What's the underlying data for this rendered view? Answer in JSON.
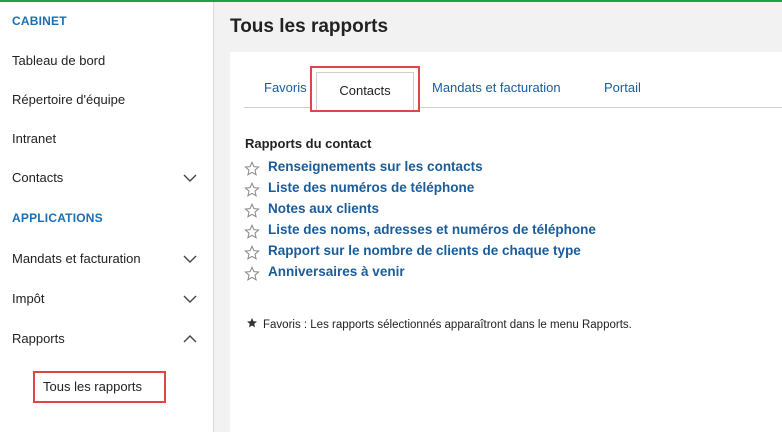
{
  "sidebar": {
    "section_cabinet": "CABINET",
    "section_applications": "APPLICATIONS",
    "items": [
      {
        "label": "Tableau de bord"
      },
      {
        "label": "Répertoire d'équipe"
      },
      {
        "label": "Intranet"
      },
      {
        "label": "Contacts"
      },
      {
        "label": "Mandats et facturation"
      },
      {
        "label": "Impôt"
      },
      {
        "label": "Rapports"
      }
    ],
    "sub_item": "Tous les rapports"
  },
  "main": {
    "title": "Tous les rapports",
    "tabs": [
      {
        "label": "Favoris"
      },
      {
        "label": "Contacts"
      },
      {
        "label": "Mandats et facturation"
      },
      {
        "label": "Portail"
      }
    ],
    "reports_heading": "Rapports du contact",
    "reports": [
      {
        "label": "Renseignements sur les contacts"
      },
      {
        "label": "Liste des numéros de téléphone"
      },
      {
        "label": "Notes aux clients"
      },
      {
        "label": "Liste des noms, adresses et numéros de téléphone"
      },
      {
        "label": "Rapport sur le nombre de clients de chaque type"
      },
      {
        "label": "Anniversaires à venir"
      }
    ],
    "footnote": "Favoris : Les rapports sélectionnés apparaîtront dans le menu Rapports."
  },
  "colors": {
    "accent_blue": "#1a6fb5",
    "link_blue": "#1a5c99",
    "highlight_red": "#e04646",
    "top_green": "#1aa34a"
  }
}
